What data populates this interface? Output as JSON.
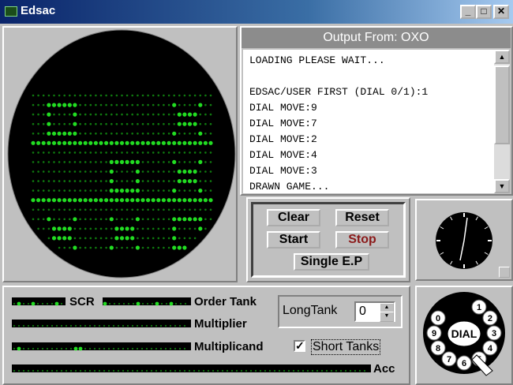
{
  "window": {
    "title": "Edsac",
    "minimize_label": "_",
    "maximize_label": "□",
    "close_label": "✕"
  },
  "output": {
    "header": "Output From: OXO",
    "lines": [
      "LOADING PLEASE WAIT...",
      "",
      "EDSAC/USER FIRST (DIAL 0/1):1",
      "DIAL MOVE:9",
      "DIAL MOVE:7",
      "DIAL MOVE:2",
      "DIAL MOVE:4",
      "DIAL MOVE:3",
      "DRAWN GAME..."
    ]
  },
  "controls": {
    "clear_label": "Clear",
    "reset_label": "Reset",
    "start_label": "Start",
    "stop_label": "Stop",
    "single_ep_label": "Single E.P"
  },
  "registers": {
    "scr_label": "SCR",
    "order_tank_label": "Order Tank",
    "multiplier_label": "Multiplier",
    "multiplicand_label": "Multiplicand",
    "acc_label": "Acc"
  },
  "longtank": {
    "label": "LongTank",
    "value": "0"
  },
  "short_tanks": {
    "label": "Short Tanks",
    "checked": true,
    "check_mark": "✓"
  },
  "dial": {
    "center_label": "DIAL",
    "digits": [
      "1",
      "2",
      "3",
      "4",
      "5",
      "6",
      "7",
      "8",
      "9",
      "0"
    ]
  },
  "board": {
    "cells": [
      "O",
      "",
      "X",
      "",
      "O",
      "X",
      "X",
      "X",
      "O"
    ]
  },
  "colors": {
    "phosphor": "#22dd22",
    "screen": "#000000",
    "panel": "#c0c0c0"
  }
}
